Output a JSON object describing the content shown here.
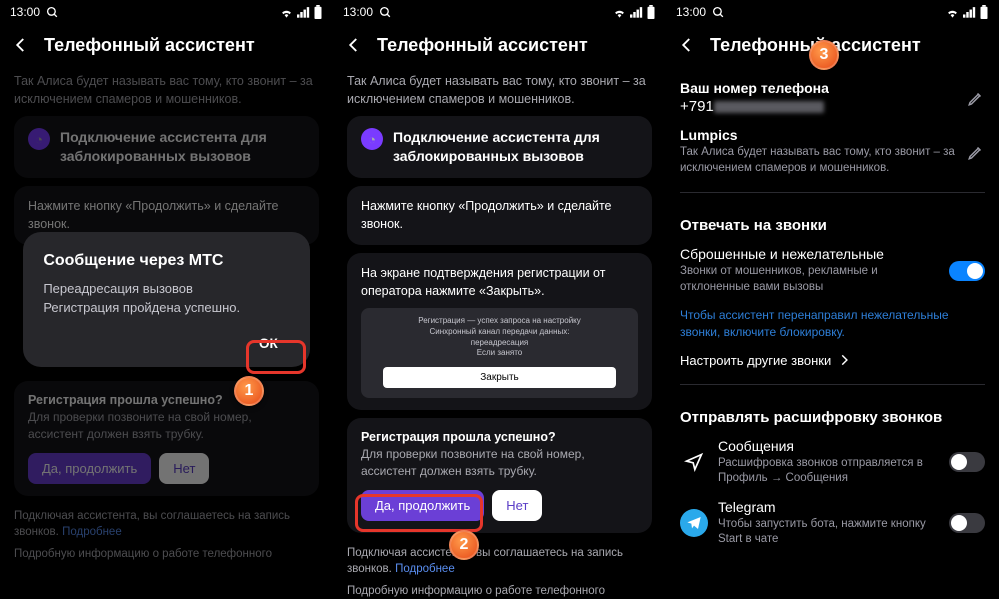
{
  "status": {
    "time": "13:00"
  },
  "title": "Телефонный ассистент",
  "intro": "Так Алиса будет называть вас тому, кто звонит – за исключением спамеров и мошенников.",
  "setup": {
    "heading": "Подключение ассистента для заблокированных вызовов",
    "step1": "Нажмите кнопку «Продолжить» и сделайте звонок.",
    "step2": "На экране подтверждения регистрации от оператора нажмите «Закрыть».",
    "mini_lines": "Регистрация — успех запроса на настройку\nСинхронный канал передачи данных:\nпереадресация\nЕсли занято",
    "mini_close": "Закрыть"
  },
  "reg": {
    "q": "Регистрация прошла успешно?",
    "t": "Для проверки позвоните на свой номер, ассистент должен взять трубку.",
    "yes": "Да, продолжить",
    "no": "Нет"
  },
  "agree": {
    "text": "Подключая ассистента, вы соглашаетесь на запись звонков.",
    "link": "Подробнее"
  },
  "more": "Подробную информацию о работе телефонного",
  "dialog": {
    "title": "Сообщение через МТС",
    "body": "Переадресация вызовов\nРегистрация пройдена успешно.",
    "ok": "ОК"
  },
  "p3": {
    "phone_label": "Ваш номер телефона",
    "phone_prefix": "+791",
    "name": "Lumpics",
    "name_sub": "Так Алиса будет называть вас тому, кто звонит – за исключением спамеров и мошенников.",
    "answer_title": "Отвечать на звонки",
    "drop_label": "Сброшенные и нежелательные",
    "drop_sub": "Звонки от мошенников, рекламные и отклоненные вами вызовы",
    "blue": "Чтобы ассистент перенаправил нежелательные звонки, включите блокировку.",
    "other": "Настроить другие звонки",
    "send_title": "Отправлять расшифровку звонков",
    "msg_label": "Сообщения",
    "msg_sub": "Расшифровка звонков отправляется в Профиль → Сообщения",
    "tg_label": "Telegram",
    "tg_sub": "Чтобы запустить бота, нажмите кнопку Start в чате"
  },
  "markers": {
    "m1": "1",
    "m2": "2",
    "m3": "3"
  }
}
